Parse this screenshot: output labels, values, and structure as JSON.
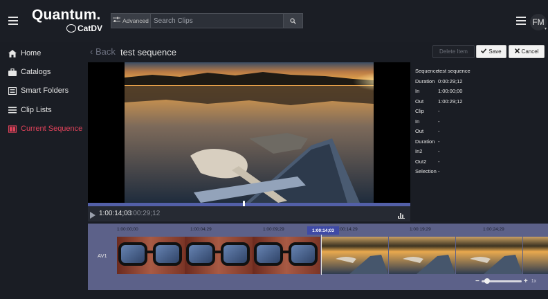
{
  "header": {
    "logo_main": "Quantum.",
    "logo_sub": "CatDV",
    "advanced_label": "Advanced",
    "search_placeholder": "Search Clips",
    "avatar_initials": "FM"
  },
  "sidebar": {
    "items": [
      {
        "label": "Home",
        "icon": "home-icon"
      },
      {
        "label": "Catalogs",
        "icon": "briefcase-icon"
      },
      {
        "label": "Smart Folders",
        "icon": "smart-folder-icon"
      },
      {
        "label": "Clip Lists",
        "icon": "list-icon"
      },
      {
        "label": "Current Sequence",
        "icon": "sequence-icon",
        "active": true
      }
    ],
    "active_color": "#e0425a"
  },
  "page": {
    "back_label": "Back",
    "title": "test sequence",
    "delete_label": "Delete Item",
    "save_label": "Save",
    "cancel_label": "Cancel"
  },
  "player": {
    "current_timecode": "1:00:14;03",
    "duration_timecode": "0:00:29;12",
    "scrub_fraction": 0.48
  },
  "metadata": [
    {
      "key": "Sequence",
      "value": "test sequence"
    },
    {
      "key": "Duration",
      "value": "0:00:29;12"
    },
    {
      "key": "In",
      "value": "1:00:00;00"
    },
    {
      "key": "Out",
      "value": "1:00:29;12"
    },
    {
      "key": "Clip",
      "value": "-"
    },
    {
      "key": "In",
      "value": "-"
    },
    {
      "key": "Out",
      "value": "-"
    },
    {
      "key": "Duration",
      "value": "-"
    },
    {
      "key": "In2",
      "value": "-"
    },
    {
      "key": "Out2",
      "value": "-"
    },
    {
      "key": "Selection",
      "value": "-"
    }
  ],
  "timeline": {
    "ruler_ticks": [
      "1:00:00;00",
      "1:00:04;29",
      "1:00:09;29",
      "1:00:14;29",
      "1:00:19;29",
      "1:00:24;29"
    ],
    "current_timecode": "1:00:14;03",
    "track_label": "AV1",
    "zoom_level": "1x"
  },
  "colors": {
    "accent": "#5360a8",
    "timeline_bg": "#5c6189",
    "page_bg": "#1a1d24"
  }
}
